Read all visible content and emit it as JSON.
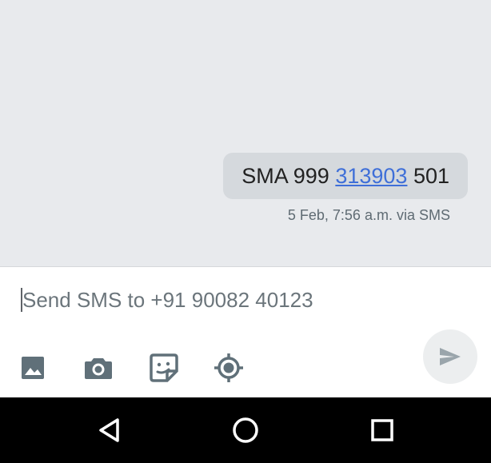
{
  "message": {
    "text_before": "SMA 999 ",
    "link_text": "313903",
    "text_after": " 501",
    "date": "5 Feb, 7:56 a.m.",
    "via": "via SMS"
  },
  "composer": {
    "placeholder": "Send SMS to +91 90082 40123",
    "attachments": [
      "image-icon",
      "camera-icon",
      "sticker-icon",
      "location-icon"
    ],
    "send": "send-icon"
  },
  "navbar": {
    "buttons": [
      "back-icon",
      "home-icon",
      "recents-icon"
    ]
  },
  "colors": {
    "background": "#e8eaed",
    "bubble": "#d5d9dd",
    "link": "#3f6fd8",
    "icon": "#607079",
    "send_icon": "#9aa5ab"
  }
}
